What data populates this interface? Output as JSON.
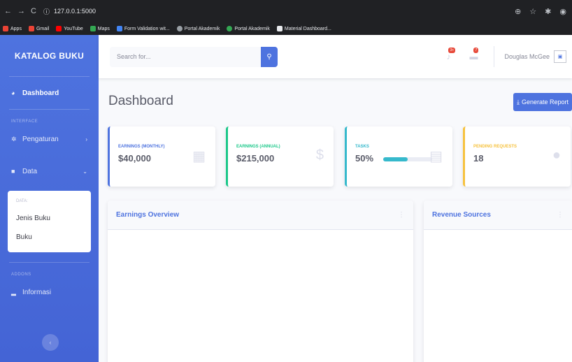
{
  "browser": {
    "url": "127.0.0.1:5000",
    "bookmarks": [
      {
        "label": "Apps",
        "color": "#ea4335"
      },
      {
        "label": "Gmail",
        "color": "#ea4335"
      },
      {
        "label": "YouTube",
        "color": "#ff0000"
      },
      {
        "label": "Maps",
        "color": "#34a853"
      },
      {
        "label": "Form Validation wit...",
        "color": "#4285f4"
      },
      {
        "label": "Portal Akademik",
        "color": "#9aa0a6"
      },
      {
        "label": "Portal Akademik",
        "color": "#34a853"
      },
      {
        "label": "Material Dashboard...",
        "color": "#e8eaed"
      }
    ]
  },
  "sidebar": {
    "brand": "KATALOG BUKU",
    "dashboard": "Dashboard",
    "interface_heading": "INTERFACE",
    "pengaturan": "Pengaturan",
    "data": "Data",
    "collapse_heading": "DATA:",
    "jenis_buku": "Jenis Buku",
    "buku": "Buku",
    "addons_heading": "ADDONS",
    "informasi": "Informasi"
  },
  "topbar": {
    "search_placeholder": "Search for...",
    "alerts_badge": "3+",
    "messages_badge": "7",
    "user_name": "Douglas McGee"
  },
  "main": {
    "title": "Dashboard",
    "generate_report": "Generate Report",
    "cards": [
      {
        "label": "EARNINGS (MONTHLY)",
        "value": "$40,000",
        "color": "#4e73df",
        "icon": "calendar-icon"
      },
      {
        "label": "EARNINGS (ANNUAL)",
        "value": "$215,000",
        "color": "#1cc88a",
        "icon": "dollar-icon"
      },
      {
        "label": "TASKS",
        "value": "50%",
        "color": "#36b9cc",
        "icon": "clipboard-icon",
        "progress": 0.5
      },
      {
        "label": "PENDING REQUESTS",
        "value": "18",
        "color": "#f6c23e",
        "icon": "comments-icon"
      }
    ],
    "earnings_overview": "Earnings Overview",
    "revenue_sources": "Revenue Sources"
  }
}
